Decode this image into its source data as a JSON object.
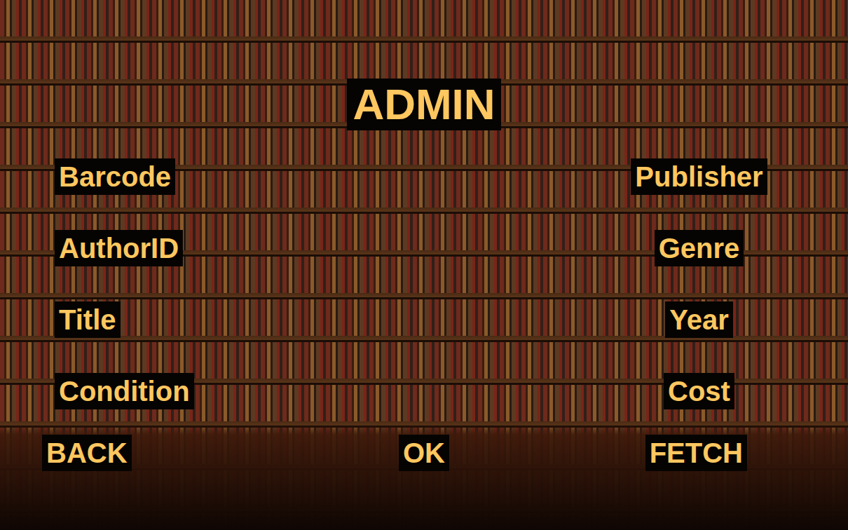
{
  "title": "ADMIN",
  "fields": {
    "left": [
      {
        "label": "Barcode"
      },
      {
        "label": "AuthorID"
      },
      {
        "label": "Title"
      },
      {
        "label": "Condition"
      }
    ],
    "right": [
      {
        "label": "Publisher"
      },
      {
        "label": "Genre"
      },
      {
        "label": "Year"
      },
      {
        "label": "Cost"
      }
    ]
  },
  "buttons": {
    "back": "BACK",
    "ok": "OK",
    "fetch": "FETCH"
  }
}
